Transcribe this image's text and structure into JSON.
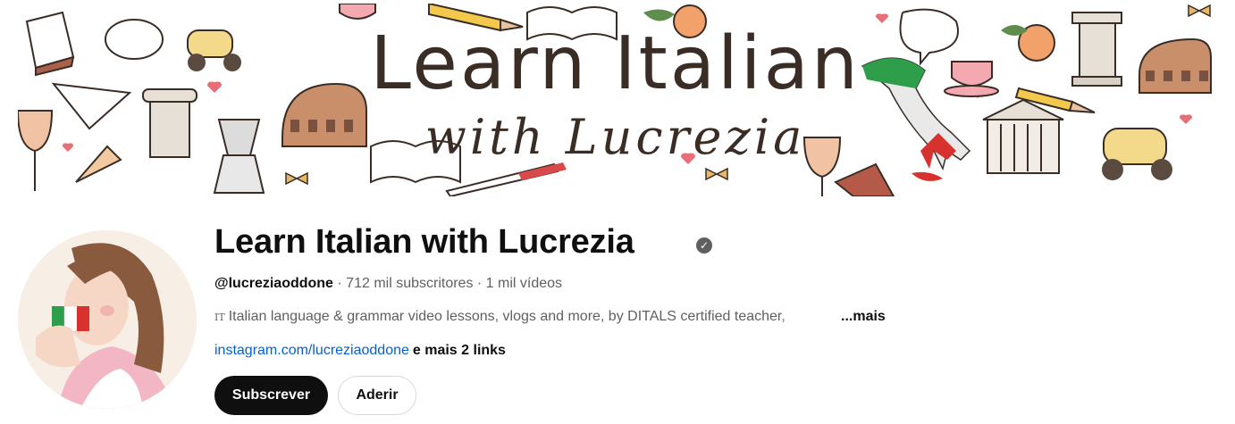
{
  "banner": {
    "title": "Learn Italian",
    "subtitle": "with Lucrezia"
  },
  "channel": {
    "name": "Learn Italian with Lucrezia",
    "verified_glyph": "✓",
    "handle": "@lucreziaoddone",
    "subscribers": "712 mil subscritores",
    "videos": "1 mil vídeos",
    "separator": " · ",
    "description_lang": "IT",
    "description": "Italian language & grammar video lessons, vlogs and more, by DITALS certified teacher,",
    "more_label": "...mais",
    "link": "instagram.com/lucreziaoddone",
    "more_links": "e mais 2 links"
  },
  "actions": {
    "subscribe_label": "Subscrever",
    "join_label": "Aderir"
  },
  "colors": {
    "link": "#065fd4",
    "subscribe_bg": "#0f0f0f",
    "secondary_text": "#606060"
  },
  "icons": {
    "verified": "verified-check-icon"
  }
}
